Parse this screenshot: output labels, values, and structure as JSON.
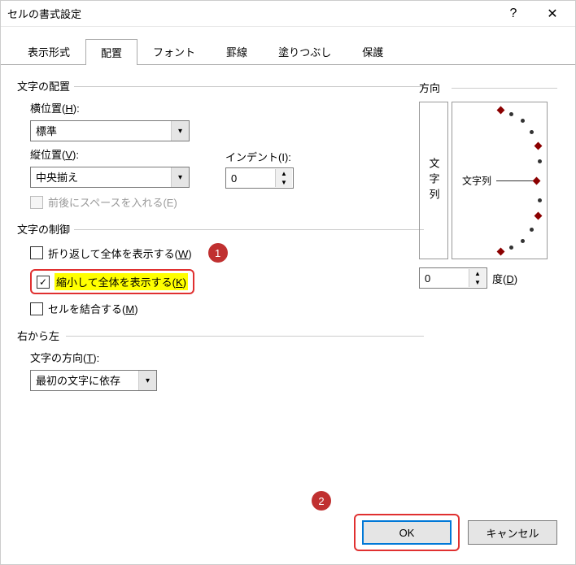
{
  "dialog": {
    "title": "セルの書式設定"
  },
  "tabs": [
    {
      "label": "表示形式",
      "active": false
    },
    {
      "label": "配置",
      "active": true
    },
    {
      "label": "フォント",
      "active": false
    },
    {
      "label": "罫線",
      "active": false
    },
    {
      "label": "塗りつぶし",
      "active": false
    },
    {
      "label": "保護",
      "active": false
    }
  ],
  "alignment": {
    "section_label": "文字の配置",
    "horizontal_label_pre": "横位置(",
    "horizontal_hotkey": "H",
    "horizontal_label_post": "):",
    "horizontal_value": "標準",
    "vertical_label_pre": "縦位置(",
    "vertical_hotkey": "V",
    "vertical_label_post": "):",
    "vertical_value": "中央揃え",
    "indent_label": "インデント(I):",
    "indent_value": "0",
    "space_label": "前後にスペースを入れる(E)"
  },
  "control": {
    "section_label": "文字の制御",
    "wrap_pre": "折り返して全体を表示する(",
    "wrap_hotkey": "W",
    "wrap_post": ")",
    "shrink_pre": "縮小して全体を表示する(",
    "shrink_hotkey": "K",
    "shrink_post": ")",
    "merge_pre": "セルを結合する(",
    "merge_hotkey": "M",
    "merge_post": ")"
  },
  "rtl": {
    "section_label": "右から左",
    "dir_label_pre": "文字の方向(",
    "dir_hotkey": "T",
    "dir_label_post": "):",
    "dir_value": "最初の文字に依存"
  },
  "orientation": {
    "section_label": "方向",
    "vertical_text": "文字列",
    "dial_text": "文字列",
    "degree_value": "0",
    "degree_label_pre": "度(",
    "degree_hotkey": "D",
    "degree_label_post": ")"
  },
  "buttons": {
    "ok": "OK",
    "cancel": "キャンセル"
  },
  "annotations": {
    "one": "1",
    "two": "2"
  }
}
